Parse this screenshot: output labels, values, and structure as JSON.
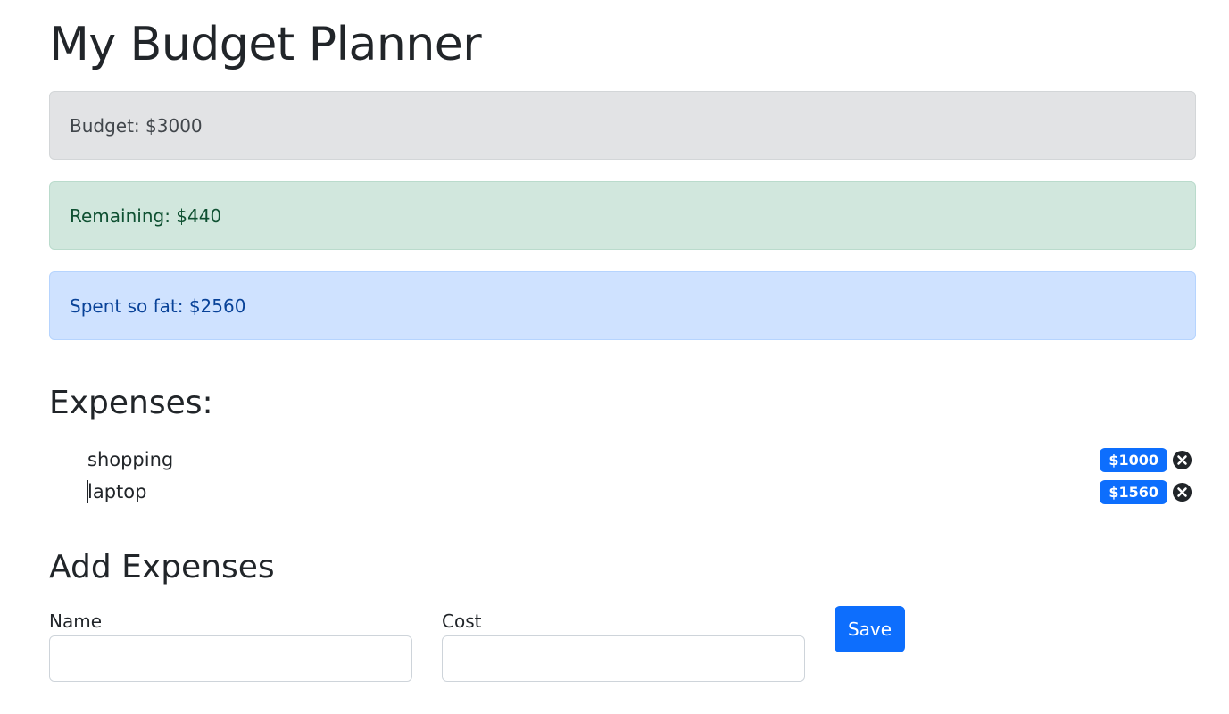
{
  "header": {
    "title": "My Budget Planner"
  },
  "summary": {
    "budget": "Budget: $3000",
    "remaining": "Remaining: $440",
    "spent": "Spent so fat: $2560"
  },
  "expenses": {
    "title": "Expenses:",
    "items": [
      {
        "name": "shopping",
        "cost": "$1000"
      },
      {
        "name": "laptop",
        "cost": "$1560"
      }
    ]
  },
  "add_form": {
    "title": "Add Expenses",
    "name_label": "Name",
    "name_value": "",
    "cost_label": "Cost",
    "cost_value": "",
    "save_label": "Save"
  },
  "icons": {
    "delete": "close-circle-icon"
  },
  "colors": {
    "primary": "#0d6efd",
    "secondary_bg": "#e2e3e5",
    "success_bg": "#d1e7dd",
    "primary_bg": "#cfe2ff"
  }
}
